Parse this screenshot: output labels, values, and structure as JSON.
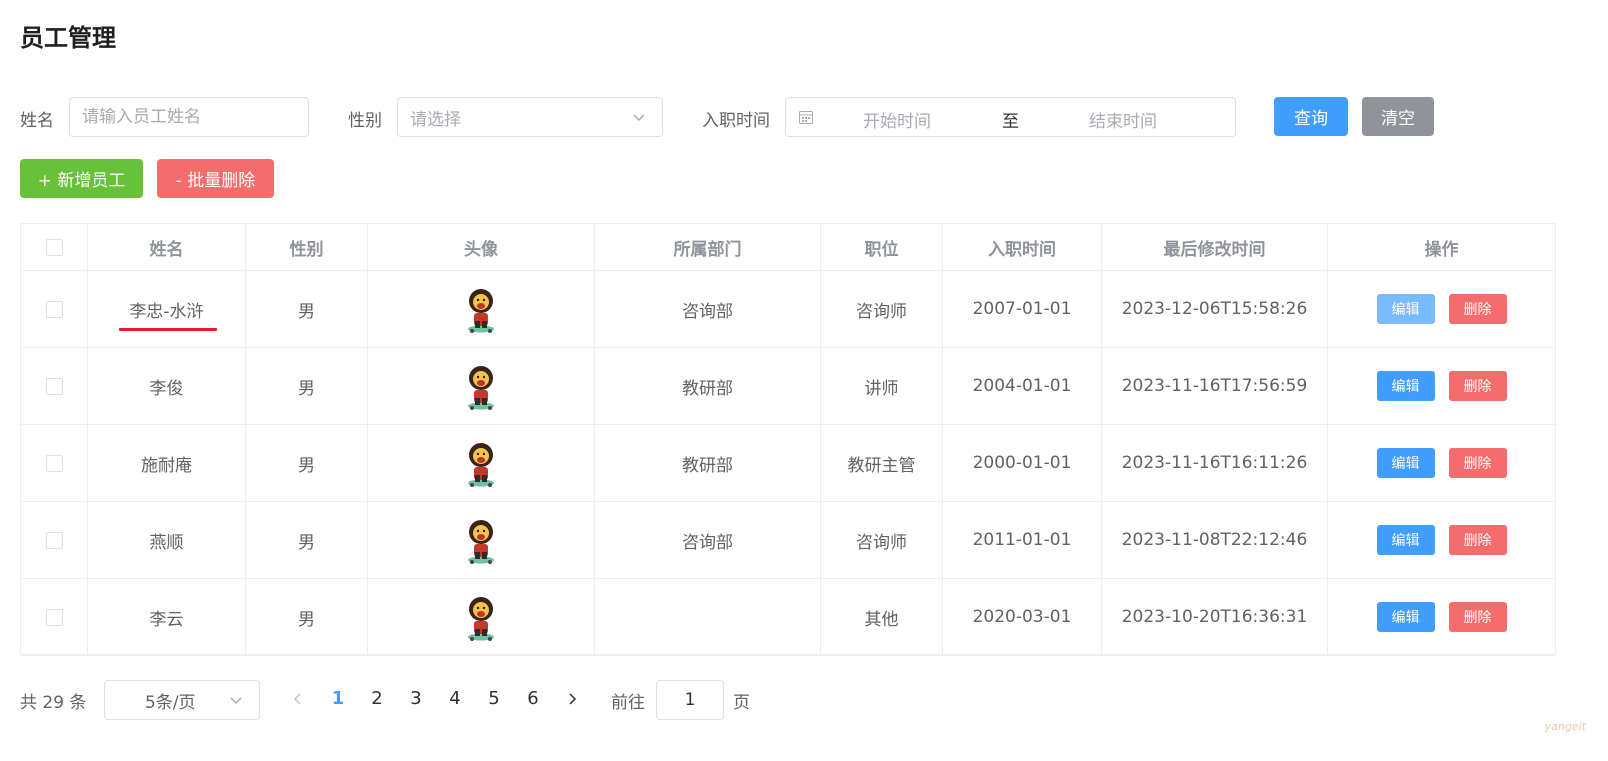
{
  "page": {
    "title": "员工管理"
  },
  "search": {
    "name_label": "姓名",
    "name_placeholder": "请输入员工姓名",
    "gender_label": "性别",
    "gender_placeholder": "请选择",
    "date_label": "入职时间",
    "date_start_placeholder": "开始时间",
    "date_separator": "至",
    "date_end_placeholder": "结束时间",
    "query_label": "查询",
    "clear_label": "清空"
  },
  "toolbar": {
    "add_label": "+ 新增员工",
    "batch_delete_label": "- 批量删除"
  },
  "table": {
    "columns": [
      "姓名",
      "性别",
      "头像",
      "所属部门",
      "职位",
      "入职时间",
      "最后修改时间",
      "操作"
    ],
    "edit_label": "编辑",
    "delete_label": "删除",
    "rows": [
      {
        "name": "李忠-水浒",
        "gender": "男",
        "dept": "咨询部",
        "job": "咨询师",
        "entry": "2007-01-01",
        "updated": "2023-12-06T15:58:26"
      },
      {
        "name": "李俊",
        "gender": "男",
        "dept": "教研部",
        "job": "讲师",
        "entry": "2004-01-01",
        "updated": "2023-11-16T17:56:59"
      },
      {
        "name": "施耐庵",
        "gender": "男",
        "dept": "教研部",
        "job": "教研主管",
        "entry": "2000-01-01",
        "updated": "2023-11-16T16:11:26"
      },
      {
        "name": "燕顺",
        "gender": "男",
        "dept": "咨询部",
        "job": "咨询师",
        "entry": "2011-01-01",
        "updated": "2023-11-08T22:12:46"
      },
      {
        "name": "李云",
        "gender": "男",
        "dept": "",
        "job": "其他",
        "entry": "2020-03-01",
        "updated": "2023-10-20T16:36:31"
      }
    ]
  },
  "pagination": {
    "total": "共 29 条",
    "page_size": "5条/页",
    "pages": [
      "1",
      "2",
      "3",
      "4",
      "5",
      "6"
    ],
    "current": "1",
    "goto_prefix": "前往",
    "goto_value": "1",
    "goto_suffix": "页"
  },
  "watermark": "yangeit",
  "colors": {
    "primary": "#409eff",
    "danger": "#f56c6c",
    "success": "#67c23a",
    "info": "#909399"
  }
}
